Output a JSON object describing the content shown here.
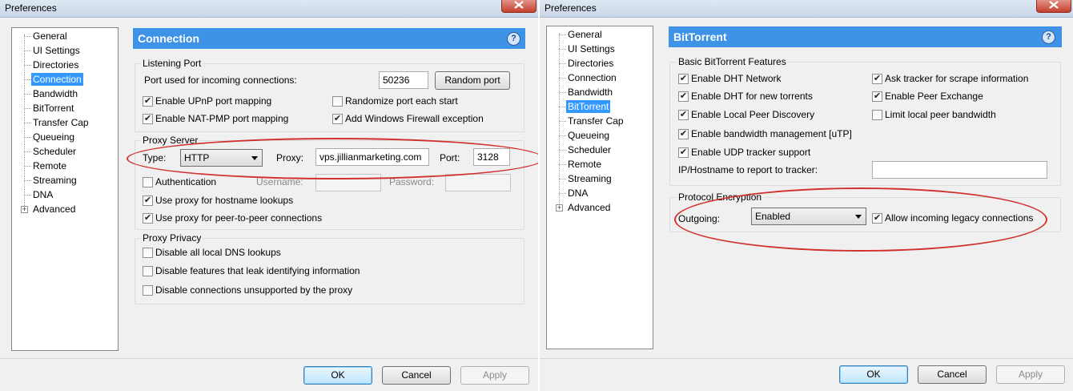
{
  "left": {
    "title": "Preferences",
    "tree": [
      "General",
      "UI Settings",
      "Directories",
      "Connection",
      "Bandwidth",
      "BitTorrent",
      "Transfer Cap",
      "Queueing",
      "Scheduler",
      "Remote",
      "Streaming",
      "DNA",
      "Advanced"
    ],
    "selected": "Connection",
    "header": "Connection",
    "help_icon": "?",
    "listening": {
      "title": "Listening Port",
      "port_label": "Port used for incoming connections:",
      "port_value": "50236",
      "random_port_btn": "Random port",
      "upnp": "Enable UPnP port mapping",
      "natpmp": "Enable NAT-PMP port mapping",
      "randomize": "Randomize port each start",
      "firewall": "Add Windows Firewall exception"
    },
    "proxy": {
      "title": "Proxy Server",
      "type_label": "Type:",
      "type_value": "HTTP",
      "proxy_label": "Proxy:",
      "proxy_value": "vps.jillianmarketing.com",
      "port_label": "Port:",
      "port_value": "3128",
      "auth": "Authentication",
      "username_label": "Username:",
      "password_label": "Password:",
      "hostname_lookups": "Use proxy for hostname lookups",
      "p2p": "Use proxy for peer-to-peer connections"
    },
    "privacy": {
      "title": "Proxy Privacy",
      "dns": "Disable all local DNS lookups",
      "leak": "Disable features that leak identifying information",
      "unsupported": "Disable connections unsupported by the proxy"
    },
    "buttons": {
      "ok": "OK",
      "cancel": "Cancel",
      "apply": "Apply"
    }
  },
  "right": {
    "title": "Preferences",
    "tree": [
      "General",
      "UI Settings",
      "Directories",
      "Connection",
      "Bandwidth",
      "BitTorrent",
      "Transfer Cap",
      "Queueing",
      "Scheduler",
      "Remote",
      "Streaming",
      "DNA",
      "Advanced"
    ],
    "selected": "BitTorrent",
    "header": "BitTorrent",
    "help_icon": "?",
    "basic": {
      "title": "Basic BitTorrent Features",
      "dht_network": "Enable DHT Network",
      "dht_new": "Enable DHT for new torrents",
      "lpd": "Enable Local Peer Discovery",
      "bw_mgmt": "Enable bandwidth management [uTP]",
      "udp_tracker": "Enable UDP tracker support",
      "ip_label": "IP/Hostname to report to tracker:",
      "scrape": "Ask tracker for scrape information",
      "pex": "Enable Peer Exchange",
      "limit_local": "Limit local peer bandwidth"
    },
    "encryption": {
      "title": "Protocol Encryption",
      "outgoing_label": "Outgoing:",
      "outgoing_value": "Enabled",
      "legacy": "Allow incoming legacy connections"
    },
    "buttons": {
      "ok": "OK",
      "cancel": "Cancel",
      "apply": "Apply"
    }
  },
  "colors": {
    "header": "#3f93e6",
    "selection": "#3399ff",
    "annotation": "#d0312d"
  },
  "icons": {
    "check": "✔",
    "close": "close-icon",
    "help": "help-icon"
  }
}
